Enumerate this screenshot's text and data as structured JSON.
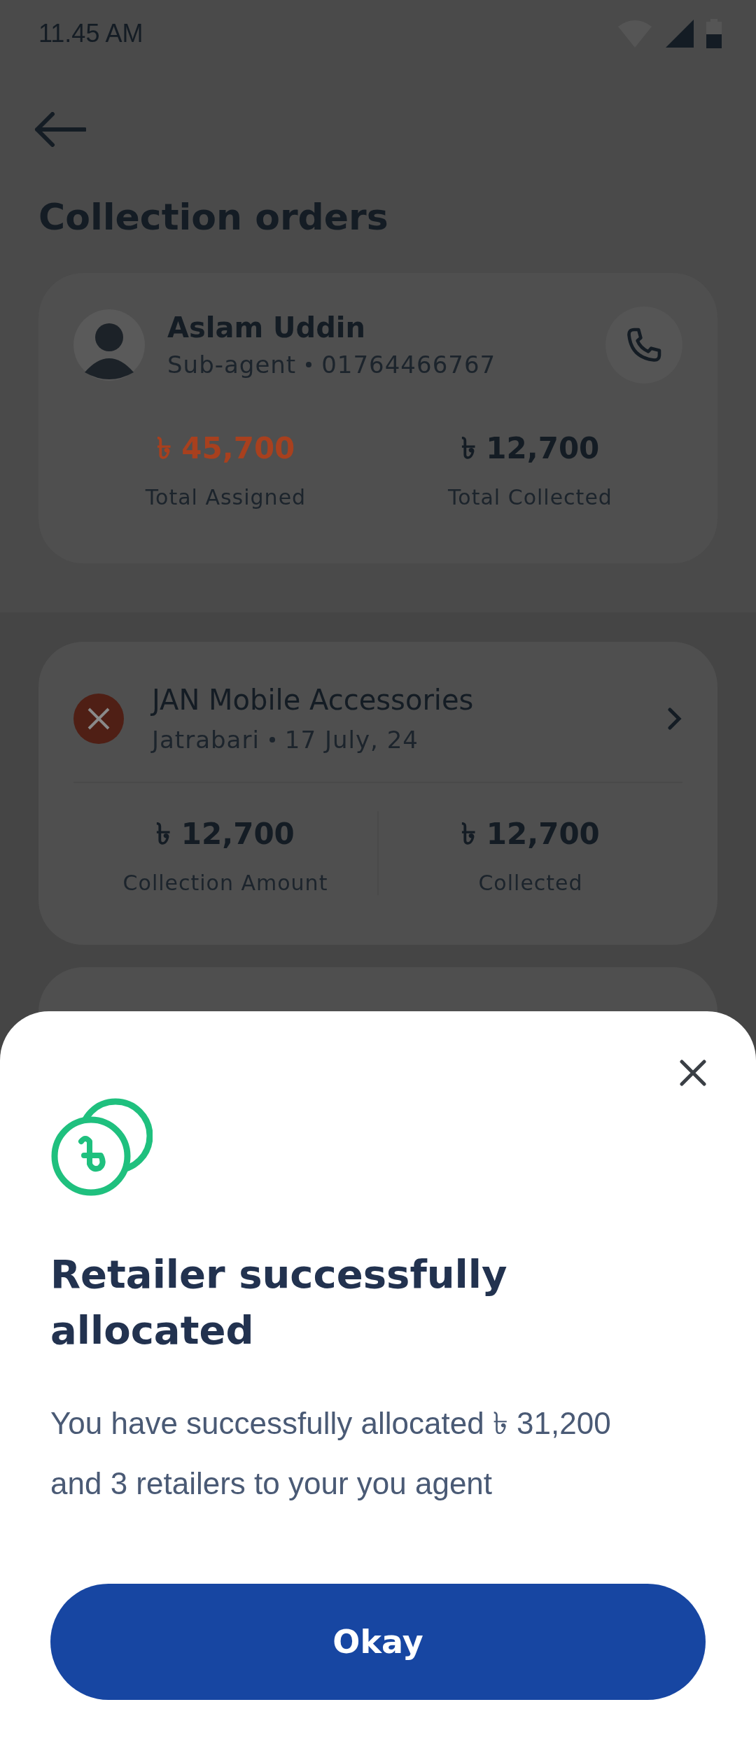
{
  "status_bar": {
    "time": "11.45 AM"
  },
  "header": {
    "title": "Collection orders"
  },
  "agent": {
    "name": "Aslam Uddin",
    "role": "Sub-agent",
    "phone": "01764466767",
    "stats": [
      {
        "amount": "৳ 45,700",
        "label": "Total Assigned",
        "kind": "assigned"
      },
      {
        "amount": "৳ 12,700",
        "label": "Total Collected",
        "kind": "collected"
      }
    ]
  },
  "orders": [
    {
      "failed": true,
      "name": "JAN Mobile Accessories",
      "location": "Jatrabari",
      "date": "17 July, 24",
      "stats": [
        {
          "amount": "৳ 12,700",
          "label": "Collection Amount"
        },
        {
          "amount": "৳ 12,700",
          "label": "Collected"
        }
      ]
    }
  ],
  "sheet": {
    "title": "Retailer successfully allocated",
    "message": "You have successfully allocated ৳ 31,200 and 3 retailers to your you agent",
    "button": "Okay"
  }
}
